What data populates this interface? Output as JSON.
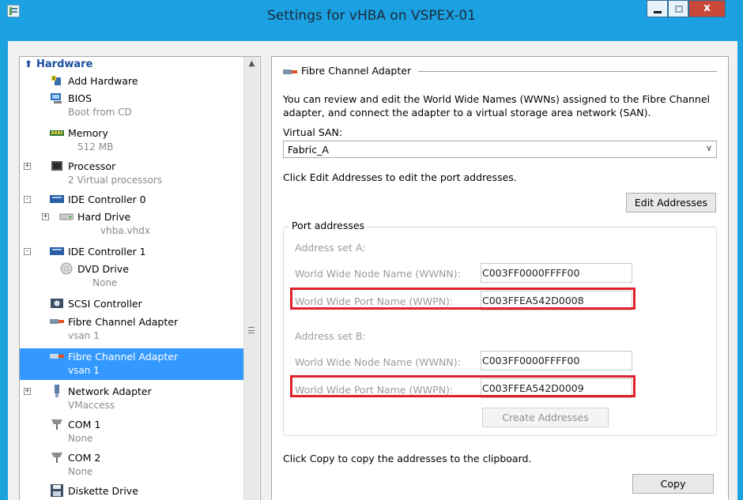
{
  "window": {
    "title": "Settings for vHBA on VSPEX-01",
    "controls": {
      "minimize": "minimize",
      "maximize": "maximize",
      "close": "x"
    }
  },
  "tree": {
    "section": "Hardware",
    "items": [
      {
        "label": "Add Hardware",
        "sub": "",
        "icon": "add-hardware-icon"
      },
      {
        "label": "BIOS",
        "sub": "Boot from CD",
        "icon": "bios-icon"
      },
      {
        "label": "Memory",
        "sub": "512 MB",
        "icon": "memory-icon"
      },
      {
        "label": "Processor",
        "sub": "2 Virtual processors",
        "icon": "processor-icon"
      },
      {
        "label": "IDE Controller 0",
        "sub": "",
        "icon": "ide-controller-icon"
      },
      {
        "label": "Hard Drive",
        "sub": "vhba.vhdx",
        "icon": "hard-drive-icon"
      },
      {
        "label": "IDE Controller 1",
        "sub": "",
        "icon": "ide-controller-icon"
      },
      {
        "label": "DVD Drive",
        "sub": "None",
        "icon": "dvd-drive-icon"
      },
      {
        "label": "SCSI Controller",
        "sub": "",
        "icon": "scsi-controller-icon"
      },
      {
        "label": "Fibre Channel Adapter",
        "sub": "vsan 1",
        "icon": "fibre-channel-icon"
      },
      {
        "label": "Fibre Channel Adapter",
        "sub": "vsan 1",
        "icon": "fibre-channel-icon"
      },
      {
        "label": "Network Adapter",
        "sub": "VMaccess",
        "icon": "network-adapter-icon"
      },
      {
        "label": "COM 1",
        "sub": "None",
        "icon": "com-port-icon"
      },
      {
        "label": "COM 2",
        "sub": "None",
        "icon": "com-port-icon"
      },
      {
        "label": "Diskette Drive",
        "sub": "",
        "icon": "diskette-icon"
      }
    ]
  },
  "panel": {
    "section_title": "Fibre Channel Adapter",
    "description": "You can review and edit the World Wide Names (WWNs) assigned to the Fibre Channel adapter, and connect the adapter to a virtual storage area network (SAN).",
    "virtual_san_label": "Virtual SAN:",
    "virtual_san_value": "Fabric_A",
    "edit_hint": "Click Edit Addresses to edit the port addresses.",
    "edit_button": "Edit Addresses",
    "port_addresses": {
      "title": "Port addresses",
      "set_a": {
        "title": "Address set A:",
        "wwnn_label": "World Wide Node Name (WWNN):",
        "wwnn_value": "C003FF0000FFFF00",
        "wwpn_label": "World Wide Port Name (WWPN):",
        "wwpn_value": "C003FFEA542D0008"
      },
      "set_b": {
        "title": "Address set B:",
        "wwnn_label": "World Wide Node Name (WWNN):",
        "wwnn_value": "C003FF0000FFFF00",
        "wwpn_label": "World Wide Port Name (WWPN):",
        "wwpn_value": "C003FFEA542D0009"
      },
      "create_button": "Create Addresses"
    },
    "copy_hint": "Click Copy to copy the addresses to the clipboard.",
    "copy_button": "Copy"
  },
  "colors": {
    "titlebar": "#1ba1e2",
    "selection": "#3399ff",
    "highlight_border": "#e0202a",
    "close_button": "#c7473b"
  }
}
